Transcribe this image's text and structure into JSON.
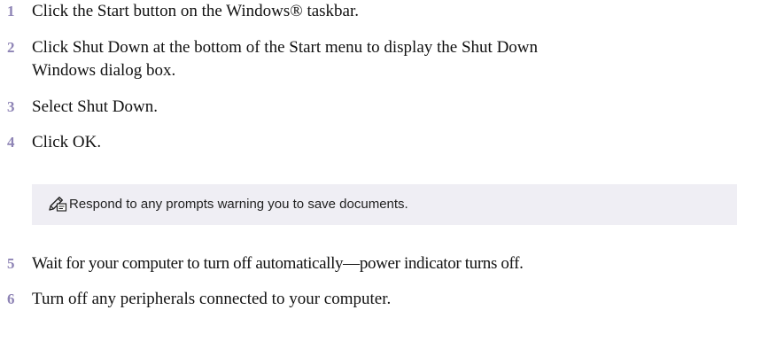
{
  "steps_before_note": [
    {
      "number": "1",
      "lines": [
        "Click the Start button on the Windows® taskbar."
      ]
    },
    {
      "number": "2",
      "lines": [
        "Click Shut Down at the bottom of the Start menu to display the Shut Down",
        "Windows dialog box."
      ]
    },
    {
      "number": "3",
      "lines": [
        "Select Shut Down."
      ]
    },
    {
      "number": "4",
      "lines": [
        "Click OK."
      ]
    }
  ],
  "note": {
    "icon": "pencil-note-icon",
    "text": "Respond to any prompts warning you to save documents."
  },
  "steps_after_note": [
    {
      "number": "5",
      "lines": [
        "Wait for your computer to turn off automatically—power indicator turns off."
      ]
    },
    {
      "number": "6",
      "lines": [
        "Turn off any peripherals connected to your computer."
      ]
    }
  ],
  "colors": {
    "step_number": "#8e84b5",
    "note_background": "#efeef4",
    "text": "#111111"
  }
}
